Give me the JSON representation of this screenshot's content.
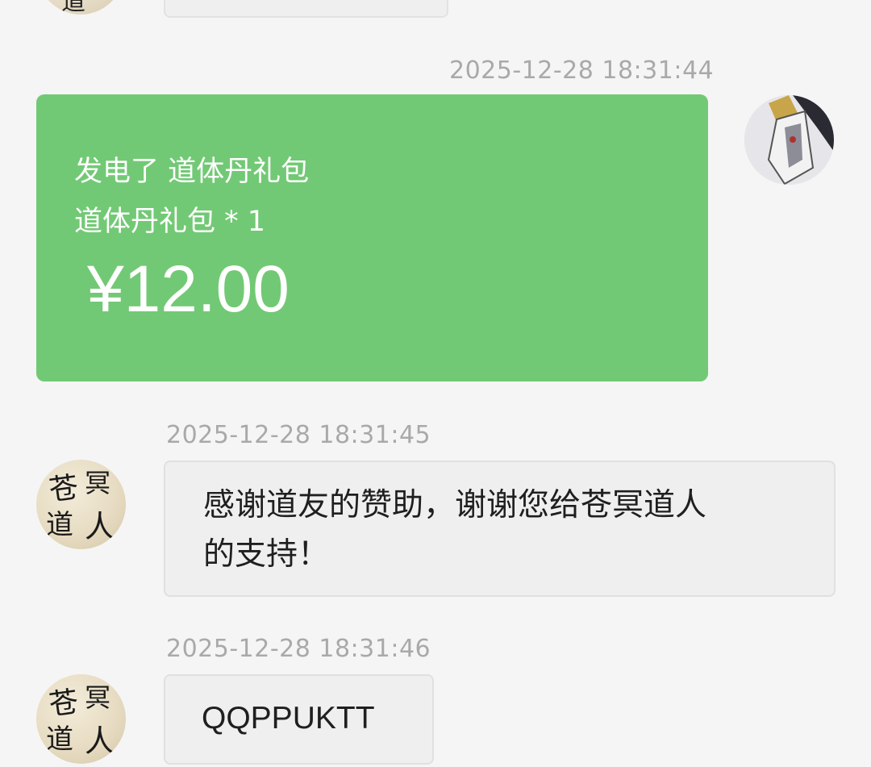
{
  "messages": [
    {
      "id": "partial-top",
      "side": "left"
    },
    {
      "id": "payment",
      "side": "right",
      "timestamp": "2025-12-28 18:31:44",
      "card": {
        "line1": "发电了 道体丹礼包",
        "line2": "道体丹礼包 * 1",
        "amount": "¥12.00",
        "color": "#72c975"
      }
    },
    {
      "id": "thanks",
      "side": "left",
      "timestamp": "2025-12-28 18:31:45",
      "text_line1": "感谢道友的赞助，谢谢您给苍冥道人",
      "text_line2": "的支持！",
      "avatar_calligraphy": "苍冥道人"
    },
    {
      "id": "code",
      "side": "left",
      "timestamp": "2025-12-28 18:31:46",
      "text": "QQPPUKTT",
      "avatar_calligraphy": "苍冥道人"
    }
  ]
}
